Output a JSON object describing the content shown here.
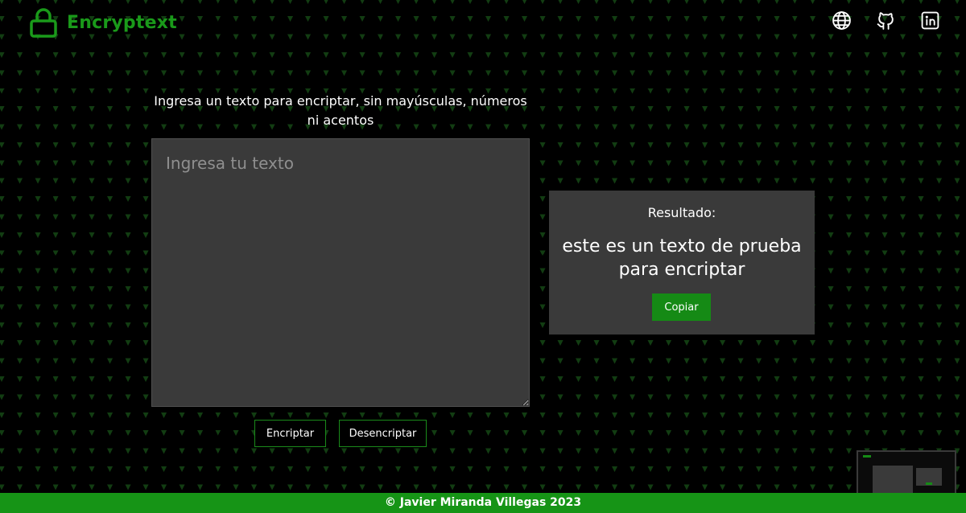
{
  "app": {
    "title": "Encryptext",
    "brand_color": "#1a9a1a",
    "logo_icon": "lock-icon"
  },
  "nav": {
    "items": [
      {
        "icon": "globe-icon",
        "label": "Website"
      },
      {
        "icon": "github-icon",
        "label": "GitHub"
      },
      {
        "icon": "linkedin-icon",
        "label": "LinkedIn"
      }
    ]
  },
  "input": {
    "instructions": "Ingresa un texto para encriptar, sin mayúsculas, números ni acentos",
    "placeholder": "Ingresa tu texto",
    "value": ""
  },
  "actions": {
    "encrypt_label": "Encriptar",
    "decrypt_label": "Desencriptar"
  },
  "result": {
    "label": "Resultado:",
    "text": "este es un texto de prueba para encriptar",
    "copy_label": "Copiar"
  },
  "footer": {
    "text": "© Javier Miranda Villegas 2023"
  }
}
